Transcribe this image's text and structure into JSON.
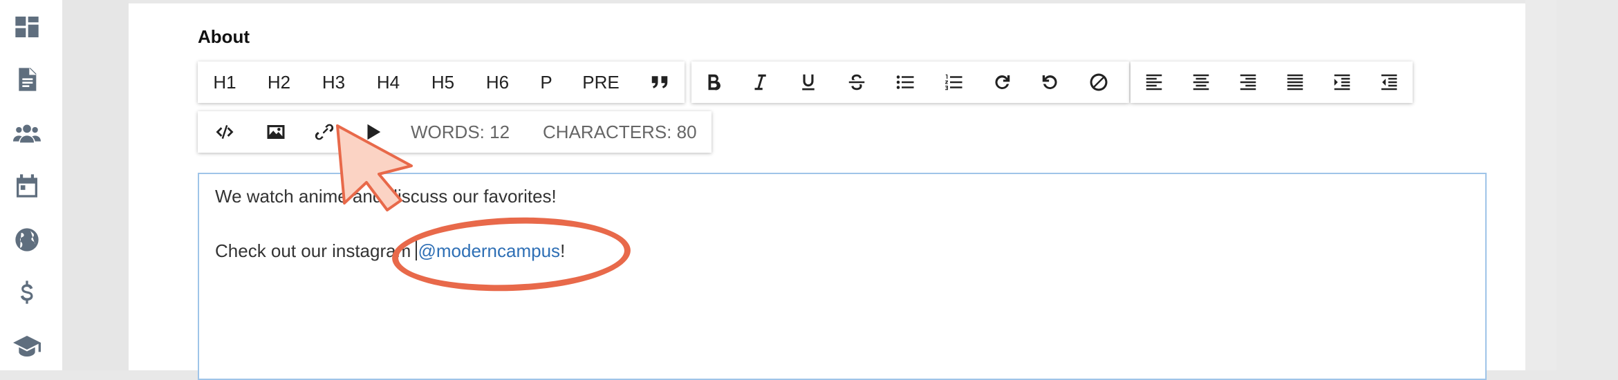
{
  "sidebar": {
    "items": [
      {
        "icon": "dashboard-icon"
      },
      {
        "icon": "document-icon"
      },
      {
        "icon": "users-icon"
      },
      {
        "icon": "calendar-icon"
      },
      {
        "icon": "globe-icon"
      },
      {
        "icon": "dollar-icon"
      },
      {
        "icon": "graduation-cap-icon"
      }
    ]
  },
  "field": {
    "label": "About"
  },
  "toolbar": {
    "headings": [
      "H1",
      "H2",
      "H3",
      "H4",
      "H5",
      "H6",
      "P",
      "PRE"
    ],
    "quote_icon": "quote-icon",
    "format_icons": [
      "bold-icon",
      "italic-icon",
      "underline-icon",
      "strikethrough-icon",
      "bullet-list-icon",
      "numbered-list-icon",
      "redo-icon",
      "undo-icon",
      "clear-format-icon"
    ],
    "align_icons": [
      "align-left-icon",
      "align-center-icon",
      "align-right-icon",
      "align-justify-icon",
      "indent-icon",
      "outdent-icon"
    ],
    "insert_icons": [
      "code-icon",
      "image-icon",
      "link-icon",
      "video-icon"
    ],
    "words": "WORDS: 12",
    "characters": "CHARACTERS: 80"
  },
  "editor": {
    "line1": "We watch anime and discuss our favorites!",
    "line2_prefix": "Check out our instagram ",
    "mention": "@moderncampus",
    "line2_suffix": "!"
  },
  "annotation": {
    "highlight_color": "#e8694a",
    "cursor_color": "#fbd3c4"
  }
}
